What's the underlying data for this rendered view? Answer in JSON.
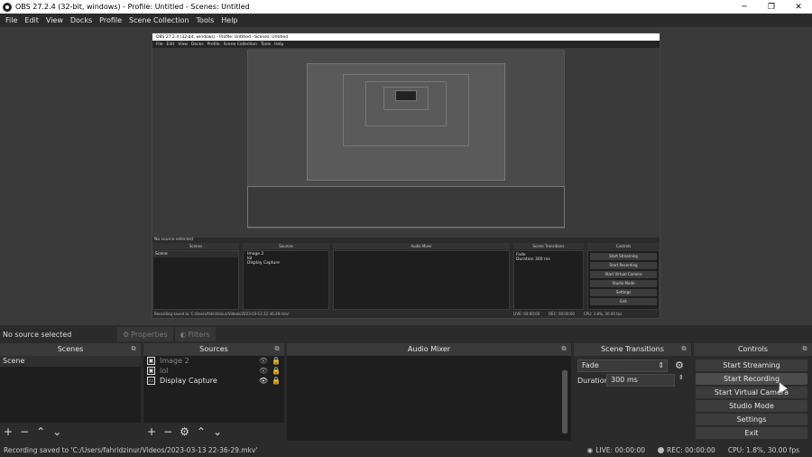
{
  "window": {
    "title": "OBS 27.2.4 (32-bit, windows) - Profile: Untitled - Scenes: Untitled",
    "minimize": "─",
    "maximize": "❐",
    "close": "✕"
  },
  "menu": [
    "File",
    "Edit",
    "View",
    "Docks",
    "Profile",
    "Scene Collection",
    "Tools",
    "Help"
  ],
  "nested": {
    "title": "OBS 27.2.4 (32-bit, windows) - Profile: Untitled - Scenes: Untitled",
    "menu": [
      "File",
      "Edit",
      "View",
      "Docks",
      "Profile",
      "Scene Collection",
      "Tools",
      "Help"
    ],
    "no_source": "No source selected",
    "scenes_header": "Scenes",
    "sources_header": "Sources",
    "mixer_header": "Audio Mixer",
    "transitions_header": "Scene Transitions",
    "controls_header": "Controls",
    "scene": "Scene",
    "sources": [
      "Image 2",
      "lol",
      "Display Capture"
    ],
    "fade": "Fade",
    "duration": "Duration",
    "duration_value": "300 ms",
    "controls": [
      "Start Streaming",
      "Start Recording",
      "Start Virtual Camera",
      "Studio Mode",
      "Settings",
      "Exit"
    ],
    "status": "Recording saved to 'C:/Users/fahridzinur/Videos/2023-03-13 22-36-29.mkv'",
    "live": "LIVE: 00:00:00",
    "rec": "REC: 00:00:00",
    "cpu": "CPU: 1.8%, 30.00 fps"
  },
  "source_bar": {
    "no_source": "No source selected",
    "properties": "Properties",
    "filters": "Filters"
  },
  "scenes": {
    "header": "Scenes",
    "items": [
      "Scene"
    ]
  },
  "sources": {
    "header": "Sources",
    "items": [
      {
        "name": "Image 2",
        "icon": "image-icon",
        "visible": false
      },
      {
        "name": "lol",
        "icon": "image-icon",
        "visible": false
      },
      {
        "name": "Display Capture",
        "icon": "monitor-icon",
        "visible": true
      }
    ]
  },
  "mixer": {
    "header": "Audio Mixer"
  },
  "transitions": {
    "header": "Scene Transitions",
    "selected": "Fade",
    "duration_label": "Duration",
    "duration_value": "300 ms"
  },
  "controls": {
    "header": "Controls",
    "buttons": [
      "Start Streaming",
      "Start Recording",
      "Start Virtual Camera",
      "Studio Mode",
      "Settings",
      "Exit"
    ]
  },
  "status": {
    "message": "Recording saved to 'C:/Users/fahridzinur/Videos/2023-03-13 22-36-29.mkv'",
    "live": "LIVE: 00:00:00",
    "rec": "REC: 00:00:00",
    "cpu": "CPU: 1.8%, 30.00 fps"
  }
}
